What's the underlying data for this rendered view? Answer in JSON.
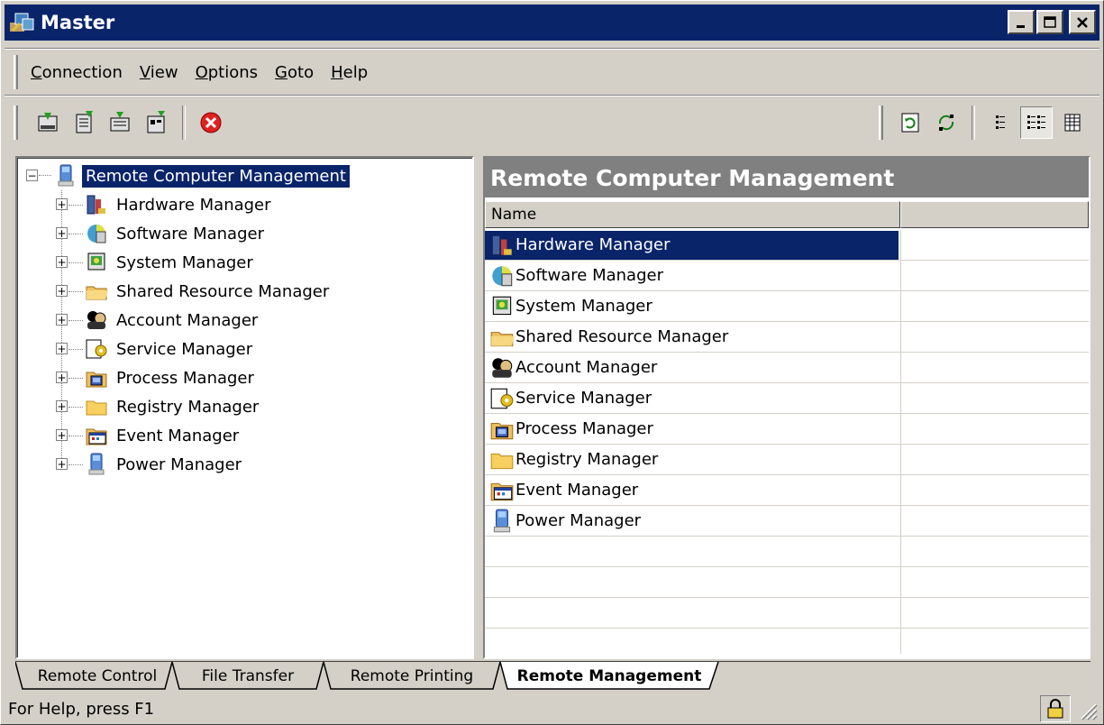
{
  "window": {
    "title": "Master",
    "minimize_label": "_",
    "maximize_label": "□",
    "close_label": "✕"
  },
  "menu": {
    "items": [
      {
        "label": "Connection",
        "accel": "C",
        "rest": "onnection"
      },
      {
        "label": "View",
        "accel": "V",
        "rest": "iew"
      },
      {
        "label": "Options",
        "accel": "O",
        "rest": "ptions"
      },
      {
        "label": "Goto",
        "accel": "G",
        "rest": "oto"
      },
      {
        "label": "Help",
        "accel": "H",
        "rest": "elp"
      }
    ]
  },
  "toolbar": {
    "left_icons": [
      "connect-icon",
      "disconnect-icon",
      "properties-icon",
      "settings-icon",
      "stop-icon"
    ],
    "right_icons": [
      "refresh-icon",
      "sync-icon",
      "view-list-icon",
      "view-details-icon",
      "view-grid-icon"
    ]
  },
  "tree": {
    "root": "Remote Computer Management",
    "expander_collapsed": "+",
    "expander_expanded": "−",
    "items": [
      {
        "label": "Hardware Manager",
        "icon": "hardware-icon"
      },
      {
        "label": "Software Manager",
        "icon": "software-icon"
      },
      {
        "label": "System Manager",
        "icon": "system-icon"
      },
      {
        "label": "Shared Resource Manager",
        "icon": "shared-folder-icon"
      },
      {
        "label": "Account Manager",
        "icon": "account-icon"
      },
      {
        "label": "Service Manager",
        "icon": "service-icon"
      },
      {
        "label": "Process Manager",
        "icon": "process-icon"
      },
      {
        "label": "Registry Manager",
        "icon": "folder-icon"
      },
      {
        "label": "Event Manager",
        "icon": "event-icon"
      },
      {
        "label": "Power Manager",
        "icon": "power-icon"
      }
    ]
  },
  "list": {
    "header": "Remote Computer Management",
    "columns": [
      "Name",
      ""
    ],
    "rows": [
      {
        "name": "Hardware Manager",
        "selected": true
      },
      {
        "name": "Software Manager"
      },
      {
        "name": "System Manager"
      },
      {
        "name": "Shared Resource Manager"
      },
      {
        "name": "Account Manager"
      },
      {
        "name": "Service Manager"
      },
      {
        "name": "Process Manager"
      },
      {
        "name": "Registry Manager"
      },
      {
        "name": "Event Manager"
      },
      {
        "name": "Power Manager"
      }
    ]
  },
  "tabs": {
    "items": [
      "Remote Control",
      "File Transfer",
      "Remote Printing",
      "Remote Management"
    ],
    "active": "Remote Management"
  },
  "status": {
    "text": "For Help, press F1"
  },
  "colors": {
    "titlebar": "#0a246a",
    "selection": "#0a246a",
    "face": "#d4d0c8",
    "header_band": "#808080"
  }
}
